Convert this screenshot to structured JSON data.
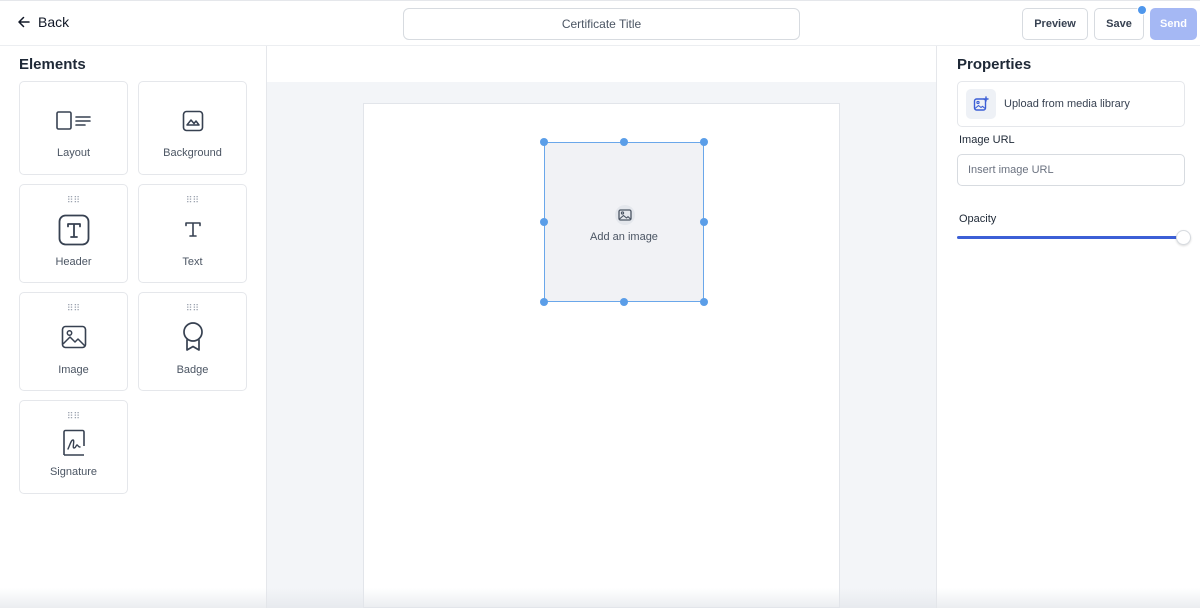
{
  "header": {
    "back_label": "Back",
    "title_value": "Certificate Title",
    "preview_label": "Preview",
    "save_label": "Save",
    "send_label": "Send"
  },
  "elements_panel": {
    "title": "Elements",
    "items": [
      {
        "label": "Layout",
        "icon": "layout-icon"
      },
      {
        "label": "Background",
        "icon": "background-icon"
      },
      {
        "label": "Header",
        "icon": "header-icon"
      },
      {
        "label": "Text",
        "icon": "text-icon"
      },
      {
        "label": "Image",
        "icon": "image-icon"
      },
      {
        "label": "Badge",
        "icon": "badge-icon"
      },
      {
        "label": "Signature",
        "icon": "signature-icon"
      }
    ]
  },
  "canvas": {
    "image_placeholder_label": "Add an image"
  },
  "properties_panel": {
    "title": "Properties",
    "upload_label": "Upload from media library",
    "image_url_label": "Image URL",
    "image_url_placeholder": "Insert image URL",
    "image_url_value": "",
    "opacity_label": "Opacity",
    "opacity_value": 1.0
  },
  "colors": {
    "accent": "#3c5fd6",
    "send_disabled": "#a5b8f4",
    "selection": "#5b9ee8"
  }
}
